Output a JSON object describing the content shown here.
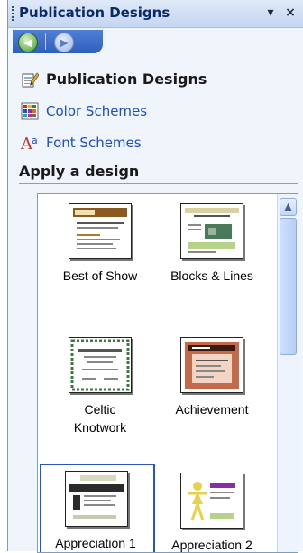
{
  "pane": {
    "title": "Publication Designs",
    "menu_icon": "dropdown-arrow-icon",
    "close_icon": "close-icon"
  },
  "nav": {
    "back_icon": "back-arrow-icon",
    "forward_icon": "forward-arrow-icon"
  },
  "links": [
    {
      "label": "Publication Designs",
      "icon": "publication-designs-icon"
    },
    {
      "label": "Color Schemes",
      "icon": "color-grid-icon"
    },
    {
      "label": "Font Schemes",
      "icon": "font-icon"
    }
  ],
  "section": {
    "title": "Apply a design"
  },
  "designs": [
    {
      "label": "Best of Show",
      "selected": false
    },
    {
      "label": "Blocks & Lines",
      "selected": false
    },
    {
      "label_line1": "Celtic",
      "label_line2": "Knotwork",
      "selected": false
    },
    {
      "label": "Achievement",
      "selected": false
    },
    {
      "label": "Appreciation  1",
      "selected": true
    },
    {
      "label": "Appreciation  2",
      "selected": false
    }
  ],
  "colors": {
    "accent": "#1f4ec9",
    "pane_background": "#f0f4fb",
    "selection_border": "#2a54b8"
  }
}
